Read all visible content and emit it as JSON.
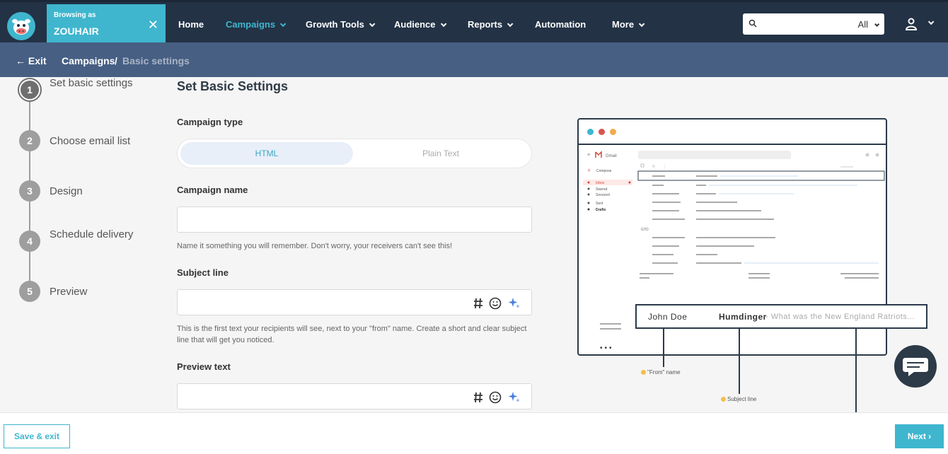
{
  "topbar": {
    "browsing_label": "Browsing as",
    "user": "ZOUHAIR",
    "close_glyph": "✕",
    "nav": [
      {
        "label": "Home",
        "active": false
      },
      {
        "label": "Campaigns",
        "active": true
      },
      {
        "label": "Growth Tools",
        "active": false
      },
      {
        "label": "Audience",
        "active": false
      },
      {
        "label": "Reports",
        "active": false
      },
      {
        "label": "Automation",
        "active": false
      },
      {
        "label": "More",
        "active": false
      }
    ],
    "search": {
      "placeholder": "",
      "scope": "All"
    }
  },
  "breadcrumb": {
    "exit": "Exit",
    "root": "Campaigns",
    "separator": "/",
    "current": "Basic settings"
  },
  "steps": [
    {
      "number": "1",
      "label": "Set basic settings"
    },
    {
      "number": "2",
      "label": "Choose email list"
    },
    {
      "number": "3",
      "label": "Design"
    },
    {
      "number": "4",
      "label": "Schedule delivery"
    },
    {
      "number": "5",
      "label": "Preview"
    }
  ],
  "form": {
    "title": "Set Basic Settings",
    "campaign_type_label": "Campaign type",
    "type_options": [
      "HTML",
      "Plain Text"
    ],
    "selected_type": "HTML",
    "campaign_name_label": "Campaign name",
    "campaign_name_value": "",
    "campaign_name_help": "Name it something you will remember. Don't worry, your receivers can't see this!",
    "subject_label": "Subject line",
    "subject_value": "",
    "subject_help": "This is the first text your recipients will see, next to your \"from\" name. Create a short and clear subject line that will get you noticed.",
    "preview_label": "Preview text",
    "preview_value": ""
  },
  "illustration": {
    "gmail_label": "Gmail",
    "compose": "Compose",
    "folders": [
      "Inbox",
      "Starred",
      "Snoozed",
      "Sent",
      "Drafts"
    ],
    "group_label": "GTD",
    "from_name": "John Doe",
    "subject": "Humdinger",
    "preview": "- What was the New England Ratriots...",
    "annotation_from": "\"From\" name",
    "annotation_subject": "Subject line"
  },
  "footer": {
    "save_exit": "Save & exit",
    "next": "Next"
  },
  "colors": {
    "accent": "#3fb6ce",
    "nav_bg": "#233245",
    "crumb_bg": "#475f83"
  }
}
